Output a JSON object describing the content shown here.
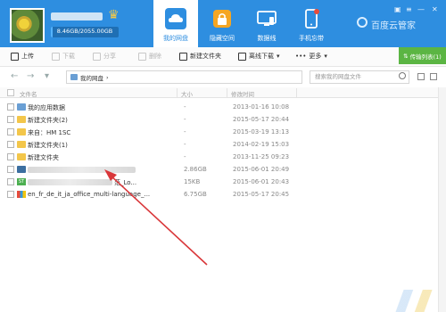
{
  "header": {
    "quota_text": "8.46GB/2055.00GB",
    "quota_fraction": 0.0041,
    "nav": [
      {
        "label": "我的网盘",
        "icon": "cloud-icon"
      },
      {
        "label": "隐藏空间",
        "icon": "lock-icon"
      },
      {
        "label": "数据线",
        "icon": "monitor-icon"
      },
      {
        "label": "手机忘带",
        "icon": "phone-icon"
      }
    ],
    "brand": "百度云管家"
  },
  "toolbar": {
    "upload": "上传",
    "download": "下载",
    "share": "分享",
    "delete": "删除",
    "new_folder": "新建文件夹",
    "offline": "离线下载",
    "more": "更多",
    "transfer": "传输列表(1)"
  },
  "address": {
    "root": "我的网盘",
    "search_placeholder": "搜索我的网盘文件"
  },
  "table": {
    "columns": {
      "name": "文件名",
      "size": "大小",
      "modified": "修改时间"
    },
    "rows": [
      {
        "name": "我的应用数据",
        "size": "-",
        "modified": "2013-01-16 10:08",
        "icon": "app-data-icon"
      },
      {
        "name": "新建文件夹(2)",
        "size": "-",
        "modified": "2015-05-17 20:44",
        "icon": "folder-icon"
      },
      {
        "name": "来自：HM 1SC",
        "size": "-",
        "modified": "2015-03-19 13:13",
        "icon": "folder-icon"
      },
      {
        "name": "新建文件夹(1)",
        "size": "-",
        "modified": "2014-02-19 15:03",
        "icon": "folder-icon"
      },
      {
        "name": "新建文件夹",
        "size": "-",
        "modified": "2013-11-25 09:23",
        "icon": "folder-icon"
      },
      {
        "name": "",
        "size": "2.86GB",
        "modified": "2015-06-01 20:49",
        "icon": "video-icon"
      },
      {
        "name": "范_Lo...",
        "size": "15KB",
        "modified": "2015-06-01 20:43",
        "icon": "txt-icon"
      },
      {
        "name": "en_fr_de_it_ja_office_multi-language_...",
        "size": "6.75GB",
        "modified": "2015-05-17 20:45",
        "icon": "package-icon"
      }
    ]
  },
  "colors": {
    "accent": "#2e8ee0",
    "transfer": "#5bb543",
    "annotation": "#d9373a"
  }
}
